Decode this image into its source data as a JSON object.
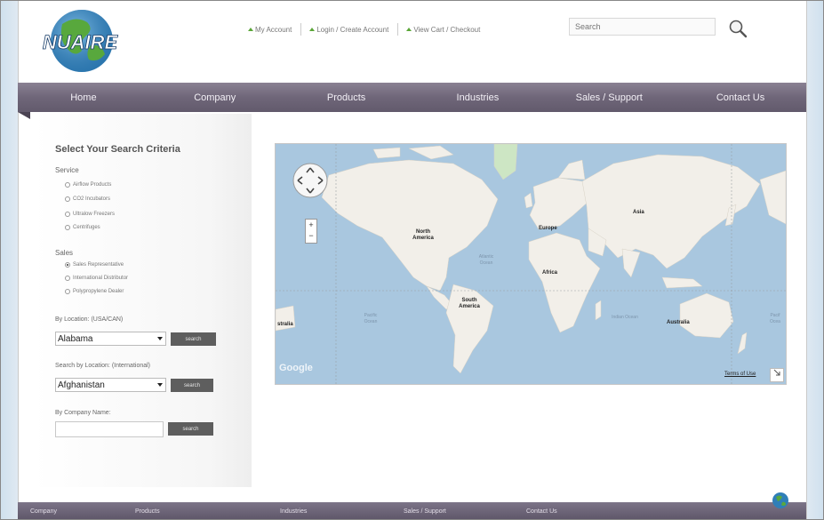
{
  "header": {
    "logo_text": "NUAIRE",
    "links": [
      {
        "label": "My Account"
      },
      {
        "label": "Login / Create Account"
      },
      {
        "label": "View Cart / Checkout"
      }
    ],
    "search_placeholder": "Search"
  },
  "nav": {
    "items": [
      {
        "label": "Home"
      },
      {
        "label": "Company"
      },
      {
        "label": "Products"
      },
      {
        "label": "Industries"
      },
      {
        "label": "Sales / Support"
      },
      {
        "label": "Contact Us"
      }
    ]
  },
  "sidebar": {
    "title": "Select Your Search Criteria",
    "service_label": "Service",
    "service_options": [
      {
        "label": "Airflow Products",
        "selected": false
      },
      {
        "label": "CO2 Incubators",
        "selected": false
      },
      {
        "label": "Ultralow Freezers",
        "selected": false
      },
      {
        "label": "Centrifuges",
        "selected": false
      }
    ],
    "sales_label": "Sales",
    "sales_options": [
      {
        "label": "Sales Representative",
        "selected": true
      },
      {
        "label": "International Distributor",
        "selected": false
      },
      {
        "label": "Polypropylene Dealer",
        "selected": false
      }
    ],
    "location_usa_label": "By Location: (USA/CAN)",
    "location_usa_value": "Alabama",
    "location_intl_label": "Search by Location: (International)",
    "location_intl_value": "Afghanistan",
    "company_label": "By Company Name:",
    "company_value": "",
    "search_button": "search"
  },
  "map": {
    "labels": {
      "north_america": "North America",
      "south_america": "South America",
      "europe": "Europe",
      "africa": "Africa",
      "asia": "Asia",
      "australia": "Australia",
      "australia_left": "stralia",
      "atlantic": "Atlantic Ocean",
      "pacific_left": "Pacific Ocean",
      "indian": "Indian Ocean",
      "pacific_right": "Pacif Ocea"
    },
    "terms": "Terms of Use",
    "google": "Google",
    "zoom_in": "+",
    "zoom_out": "−"
  },
  "footer": {
    "items": [
      {
        "label": "Company"
      },
      {
        "label": "Products"
      },
      {
        "label": "Industries"
      },
      {
        "label": "Sales / Support"
      },
      {
        "label": "Contact Us"
      }
    ]
  },
  "colors": {
    "nav_bg": "#6f6679",
    "map_water": "#a9c7df",
    "map_land": "#f2efe9",
    "button_bg": "#5e5e5e",
    "flag_green": "#5aa637"
  }
}
